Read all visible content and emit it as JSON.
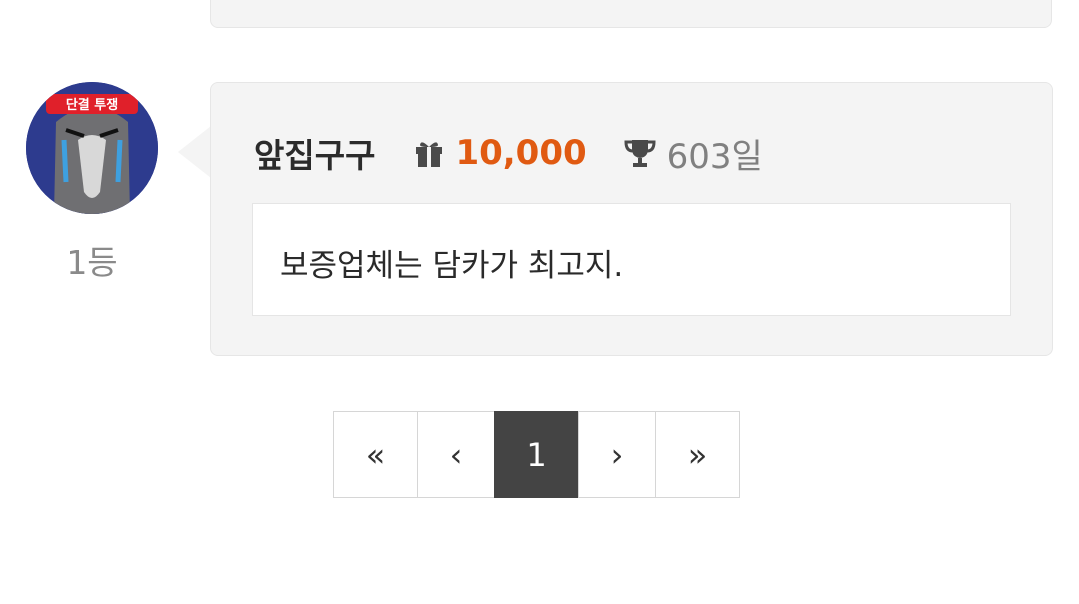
{
  "comment": {
    "rank": "1등",
    "nickname": "앞집구구",
    "points": "10,000",
    "days": "603일",
    "content": "보증업체는 담카가 최고지.",
    "avatar_banner_text": "단결 투쟁"
  },
  "pagination": {
    "first": "«",
    "prev": "‹",
    "current": "1",
    "next": "›",
    "last": "»"
  },
  "colors": {
    "points": "#e05a12",
    "active_page": "#444444",
    "card_bg": "#f4f4f4"
  }
}
